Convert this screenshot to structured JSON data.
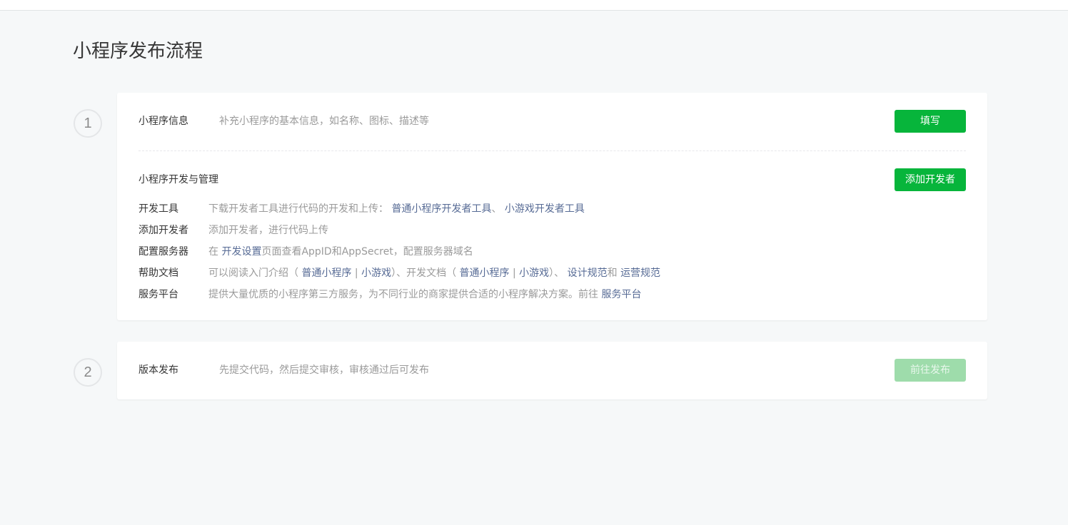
{
  "page": {
    "title": "小程序发布流程"
  },
  "steps": [
    {
      "number": "1"
    },
    {
      "number": "2"
    }
  ],
  "card1": {
    "info_title": "小程序信息",
    "info_desc": "补充小程序的基本信息，如名称、图标、描述等",
    "fill_button": "填写",
    "dev_title": "小程序开发与管理",
    "add_dev_button": "添加开发者",
    "rows": {
      "tools": {
        "label": "开发工具",
        "text": "下载开发者工具进行代码的开发和上传：",
        "link1": "普通小程序开发者工具",
        "sep": "、",
        "link2": "小游戏开发者工具"
      },
      "adddev": {
        "label": "添加开发者",
        "text": "添加开发者，进行代码上传"
      },
      "server": {
        "label": "配置服务器",
        "pre": "在",
        "link": "开发设置",
        "post": "页面查看AppID和AppSecret，配置服务器域名"
      },
      "docs": {
        "label": "帮助文档",
        "t1": "可以阅读入门介绍（",
        "l1": "普通小程序",
        "bar1": "|",
        "l2": "小游戏",
        "t2": "）、开发文档（",
        "l3": "普通小程序",
        "bar2": "|",
        "l4": "小游戏",
        "t3": "）、",
        "l5": "设计规范",
        "t4": "和",
        "l6": "运营规范"
      },
      "platform": {
        "label": "服务平台",
        "text": "提供大量优质的小程序第三方服务，为不同行业的商家提供合适的小程序解决方案。前往",
        "link": "服务平台"
      }
    }
  },
  "card2": {
    "title": "版本发布",
    "desc": "先提交代码，然后提交审核，审核通过后可发布",
    "publish_button": "前往发布"
  },
  "colors": {
    "primary": "#07b53b",
    "primary_disabled": "#9edcab",
    "link": "#576b95",
    "background": "#f6f8f9"
  }
}
